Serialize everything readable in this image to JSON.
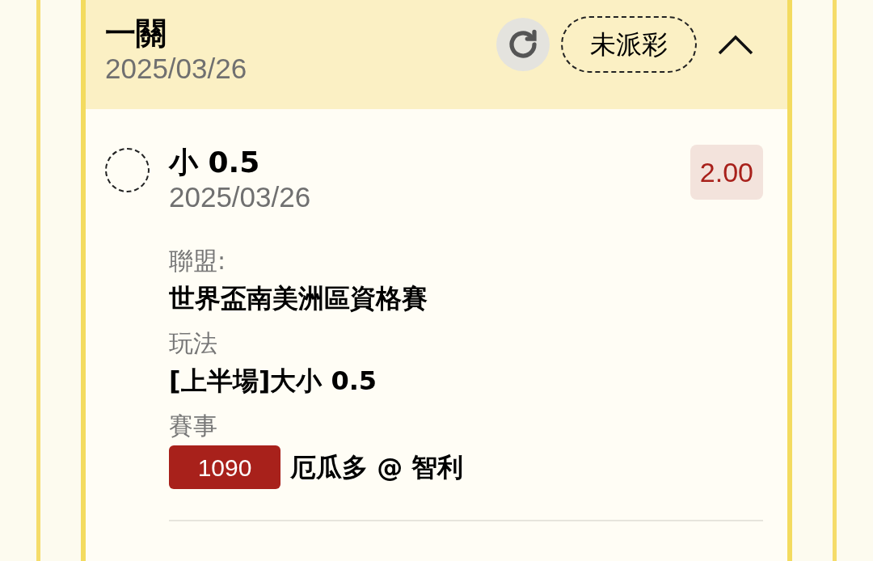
{
  "bet": {
    "type": "一關",
    "date": "2025/03/26",
    "status": "未派彩",
    "expanded": true
  },
  "selection": {
    "name": "小 0.5",
    "date": "2025/03/26",
    "odds": "2.00",
    "selected": false,
    "details": [
      {
        "label": "聯盟:",
        "value": "世界盃南美洲區資格賽"
      },
      {
        "label": "玩法",
        "value": "[上半場]大小 0.5"
      },
      {
        "label": "賽事",
        "match_number": "1090",
        "value": "厄瓜多 @ 智利"
      }
    ]
  }
}
